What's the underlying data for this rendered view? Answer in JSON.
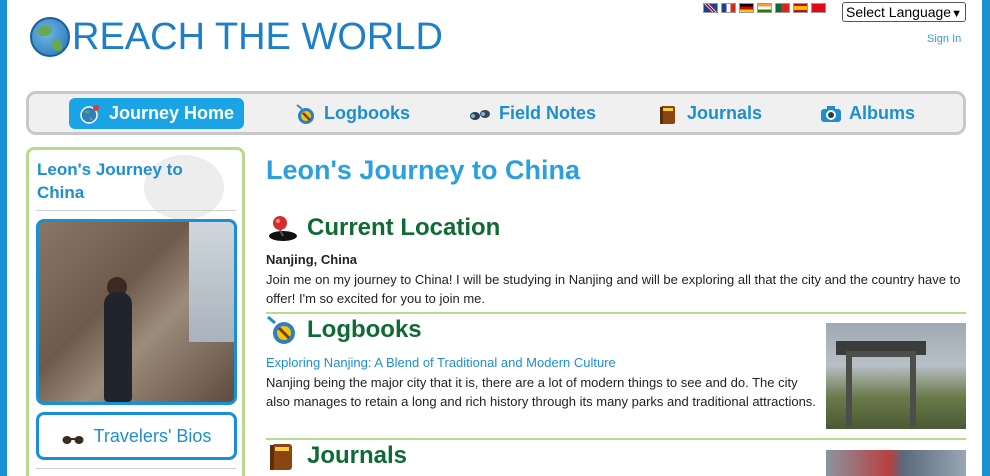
{
  "header": {
    "logo_text": "REACH THE WORLD",
    "language_select": "Select Language",
    "sign_in": "Sign In",
    "flags": [
      "uk-flag",
      "france-flag",
      "germany-flag",
      "india-flag",
      "portugal-flag",
      "spain-flag",
      "turkey-flag"
    ]
  },
  "nav": {
    "items": [
      {
        "label": "Journey Home",
        "icon": "globe-icon",
        "active": true
      },
      {
        "label": "Logbooks",
        "icon": "logbook-icon",
        "active": false
      },
      {
        "label": "Field Notes",
        "icon": "binoculars-icon",
        "active": false
      },
      {
        "label": "Journals",
        "icon": "journal-book-icon",
        "active": false
      },
      {
        "label": "Albums",
        "icon": "camera-icon",
        "active": false
      }
    ]
  },
  "sidebar": {
    "title": "Leon's Journey to China",
    "bios_label": "Travelers' Bios"
  },
  "main": {
    "title": "Leon's Journey to China",
    "current_location": {
      "heading": "Current Location",
      "city": "Nanjing, China",
      "text": "Join me on my journey to China! I will be studying in Nanjing and will be exploring all that the city and the country have to offer! I'm so excited for you to join me."
    },
    "logbooks": {
      "heading": "Logbooks",
      "link": "Exploring Nanjing: A Blend of Traditional and Modern Culture",
      "text": "Nanjing being the major city that it is, there are a lot of modern things to see and do. The city also manages to retain a long and rich history through its many parks and traditional attractions."
    },
    "journals": {
      "heading": "Journals"
    }
  },
  "colors": {
    "brand_blue": "#1d8fd1",
    "heading_green": "#0f6b33",
    "border_green": "#b9d98c",
    "frame_blue": "#1a90d4"
  }
}
